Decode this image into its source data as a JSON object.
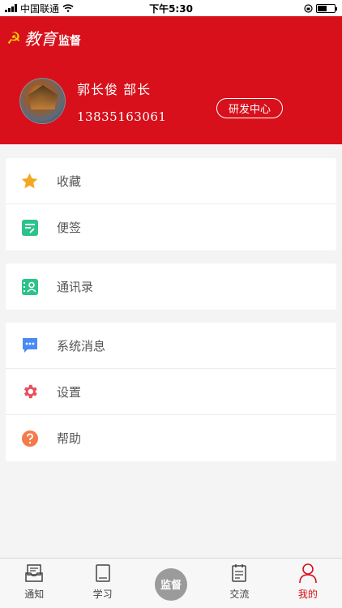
{
  "status_bar": {
    "carrier": "中国联通",
    "time": "下午5:30",
    "battery_level": 0.55
  },
  "header": {
    "logo_script": "教育",
    "logo_text": "监督",
    "brand_color": "#d7101b",
    "profile": {
      "name_title": "郭长俊 部长",
      "phone": "13835163061",
      "department": "研发中心"
    }
  },
  "menu": {
    "group1": [
      {
        "label": "收藏",
        "icon": "star-icon",
        "color": "#f5a623"
      },
      {
        "label": "便签",
        "icon": "note-icon",
        "color": "#2cc38b"
      }
    ],
    "group2": [
      {
        "label": "通讯录",
        "icon": "contacts-icon",
        "color": "#2cc38b"
      }
    ],
    "group3": [
      {
        "label": "系统消息",
        "icon": "message-icon",
        "color": "#4a8af4"
      },
      {
        "label": "设置",
        "icon": "gear-icon",
        "color": "#e8505b"
      },
      {
        "label": "帮助",
        "icon": "help-icon",
        "color": "#f47a4a"
      }
    ]
  },
  "tabbar": {
    "tabs": [
      {
        "label": "通知",
        "icon": "inbox-icon"
      },
      {
        "label": "学习",
        "icon": "book-icon"
      },
      {
        "label": "监督",
        "icon": "center-button"
      },
      {
        "label": "交流",
        "icon": "clipboard-icon"
      },
      {
        "label": "我的",
        "icon": "user-icon",
        "active": true
      }
    ],
    "active_color": "#d7101b"
  }
}
